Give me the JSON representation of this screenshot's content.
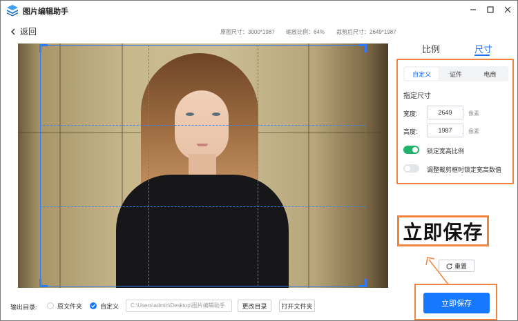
{
  "app": {
    "title": "图片编辑助手"
  },
  "header": {
    "back_label": "返回",
    "original_size": "原图尺寸：3000*1987",
    "zoom": "缩放比例：64%",
    "cropped_size": "裁剪后尺寸：2649*1987"
  },
  "panel": {
    "tabs": [
      "比例",
      "尺寸"
    ],
    "active_tab": "尺寸",
    "subtabs": [
      "自定义",
      "证件",
      "电商"
    ],
    "active_subtab": "自定义",
    "section_title": "指定尺寸",
    "width_label": "宽度:",
    "width_value": "2649",
    "height_label": "高度:",
    "height_value": "1987",
    "unit": "像素",
    "lock_ratio_label": "锁定宽高比例",
    "lock_ratio_on": true,
    "lock_on_adjust_label": "调整裁剪框时锁定宽高数值",
    "lock_on_adjust_on": false
  },
  "annotation": {
    "text": "立即保存"
  },
  "actions": {
    "reset_label": "重置",
    "save_label": "立即保存"
  },
  "output": {
    "label": "输出目录:",
    "option_original": "原文件夹",
    "option_custom": "自定义",
    "selected": "自定义",
    "path": "C:\\Users\\admin\\Desktop\\图片编辑助手",
    "change_dir": "更改目录",
    "open_folder": "打开文件夹"
  },
  "colors": {
    "accent": "#1677ff",
    "highlight": "#f1833c",
    "toggle_on": "#21b36b"
  }
}
